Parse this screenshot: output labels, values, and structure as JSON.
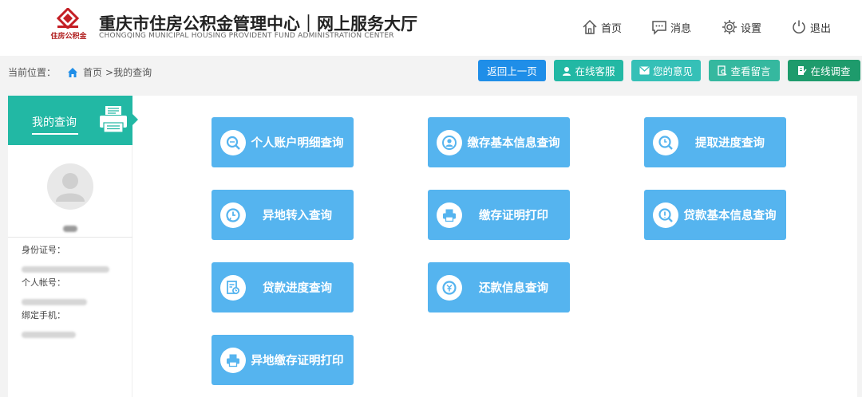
{
  "header": {
    "logo_text": "住房公积金",
    "title_cn": "重庆市住房公积金管理中心｜网上服务大厅",
    "title_en": "CHONGQING MUNICIPAL HOUSING PROVIDENT FUND ADMINISTRATION CENTER",
    "nav": [
      {
        "label": "首页",
        "icon": "home-icon"
      },
      {
        "label": "消息",
        "icon": "message-icon"
      },
      {
        "label": "设置",
        "icon": "gear-icon"
      },
      {
        "label": "退出",
        "icon": "power-icon"
      }
    ]
  },
  "breadcrumb": {
    "prefix": "当前位置：",
    "home": "首页",
    "current": ">我的查询"
  },
  "toolbar": {
    "back": "返回上一页",
    "service": "在线客服",
    "feedback": "您的意见",
    "messages": "查看留言",
    "survey": "在线调查",
    "colors": {
      "back": "#1f8ee8",
      "service": "#22b8a4",
      "feedback": "#35c0b7",
      "messages": "#35b89f",
      "survey": "#1e9b6c"
    }
  },
  "sidebar": {
    "title": "我的查询",
    "id_label": "身份证号：",
    "account_label": "个人帐号：",
    "phone_label": "绑定手机："
  },
  "tiles": [
    {
      "label": "个人账户明细查询",
      "icon": "search-doc-icon"
    },
    {
      "label": "缴存基本信息查询",
      "icon": "user-info-icon"
    },
    {
      "label": "提取进度查询",
      "icon": "progress-icon"
    },
    {
      "label": "异地转入查询",
      "icon": "transfer-icon"
    },
    {
      "label": "缴存证明打印",
      "icon": "printer-icon"
    },
    {
      "label": "贷款基本信息查询",
      "icon": "loan-info-icon"
    },
    {
      "label": "贷款进度查询",
      "icon": "loan-progress-icon"
    },
    {
      "label": "还款信息查询",
      "icon": "repayment-icon"
    },
    {
      "label": "异地缴存证明打印",
      "icon": "printer-icon"
    }
  ]
}
